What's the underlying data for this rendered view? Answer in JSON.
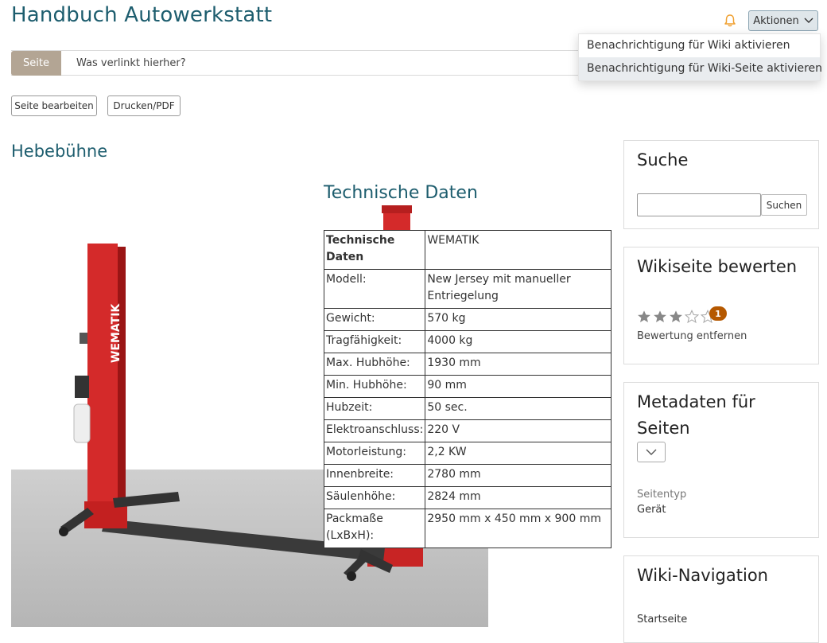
{
  "header": {
    "title": "Handbuch Autowerkstatt",
    "actions_label": "Aktionen",
    "bell_color": "#f0a030"
  },
  "actions_menu": {
    "items": [
      "Benachrichtigung für Wiki aktivieren",
      "Benachrichtigung für Wiki-Seite aktivieren"
    ]
  },
  "tabs": {
    "page": "Seite",
    "backlinks": "Was verlinkt hierher?"
  },
  "toolbar": {
    "edit": "Seite bearbeiten",
    "print": "Drucken/PDF"
  },
  "article": {
    "title": "Hebebühne",
    "image_brand": "WEMATIK",
    "tech_title": "Technische Daten",
    "table": [
      {
        "k": "Technische Daten",
        "v": "WEMATIK"
      },
      {
        "k": "Modell:",
        "v": "New Jersey mit manueller Entriegelung"
      },
      {
        "k": "Gewicht:",
        "v": "570 kg"
      },
      {
        "k": "Tragfähigkeit:",
        "v": "4000 kg"
      },
      {
        "k": "Max. Hubhöhe:",
        "v": "1930 mm"
      },
      {
        "k": "Min. Hubhöhe:",
        "v": "90 mm"
      },
      {
        "k": "Hubzeit:",
        "v": "50 sec."
      },
      {
        "k": "Elektroanschluss:",
        "v": "220 V"
      },
      {
        "k": "Motorleistung:",
        "v": "2,2 KW"
      },
      {
        "k": "Innenbreite:",
        "v": "2780 mm"
      },
      {
        "k": "Säulenhöhe:",
        "v": "2824 mm"
      },
      {
        "k": "Packmaße (LxBxH):",
        "v": "2950 mm x 450 mm x 900 mm"
      }
    ]
  },
  "sidebar": {
    "search": {
      "title": "Suche",
      "placeholder": "",
      "button": "Suchen"
    },
    "rating": {
      "title": "Wikiseite bewerten",
      "stars": 3,
      "max": 5,
      "count": "1",
      "remove": "Bewertung entfernen"
    },
    "metadata": {
      "title": "Metadaten für Seiten",
      "field_label": "Seitentyp",
      "field_value": "Gerät"
    },
    "navigation": {
      "title": "Wiki-Navigation",
      "first_item": "Startseite"
    }
  },
  "colors": {
    "accent": "#1d5d6e",
    "tab_active": "#b3a594",
    "badge": "#b55800",
    "lift_red": "#d42a2a"
  }
}
